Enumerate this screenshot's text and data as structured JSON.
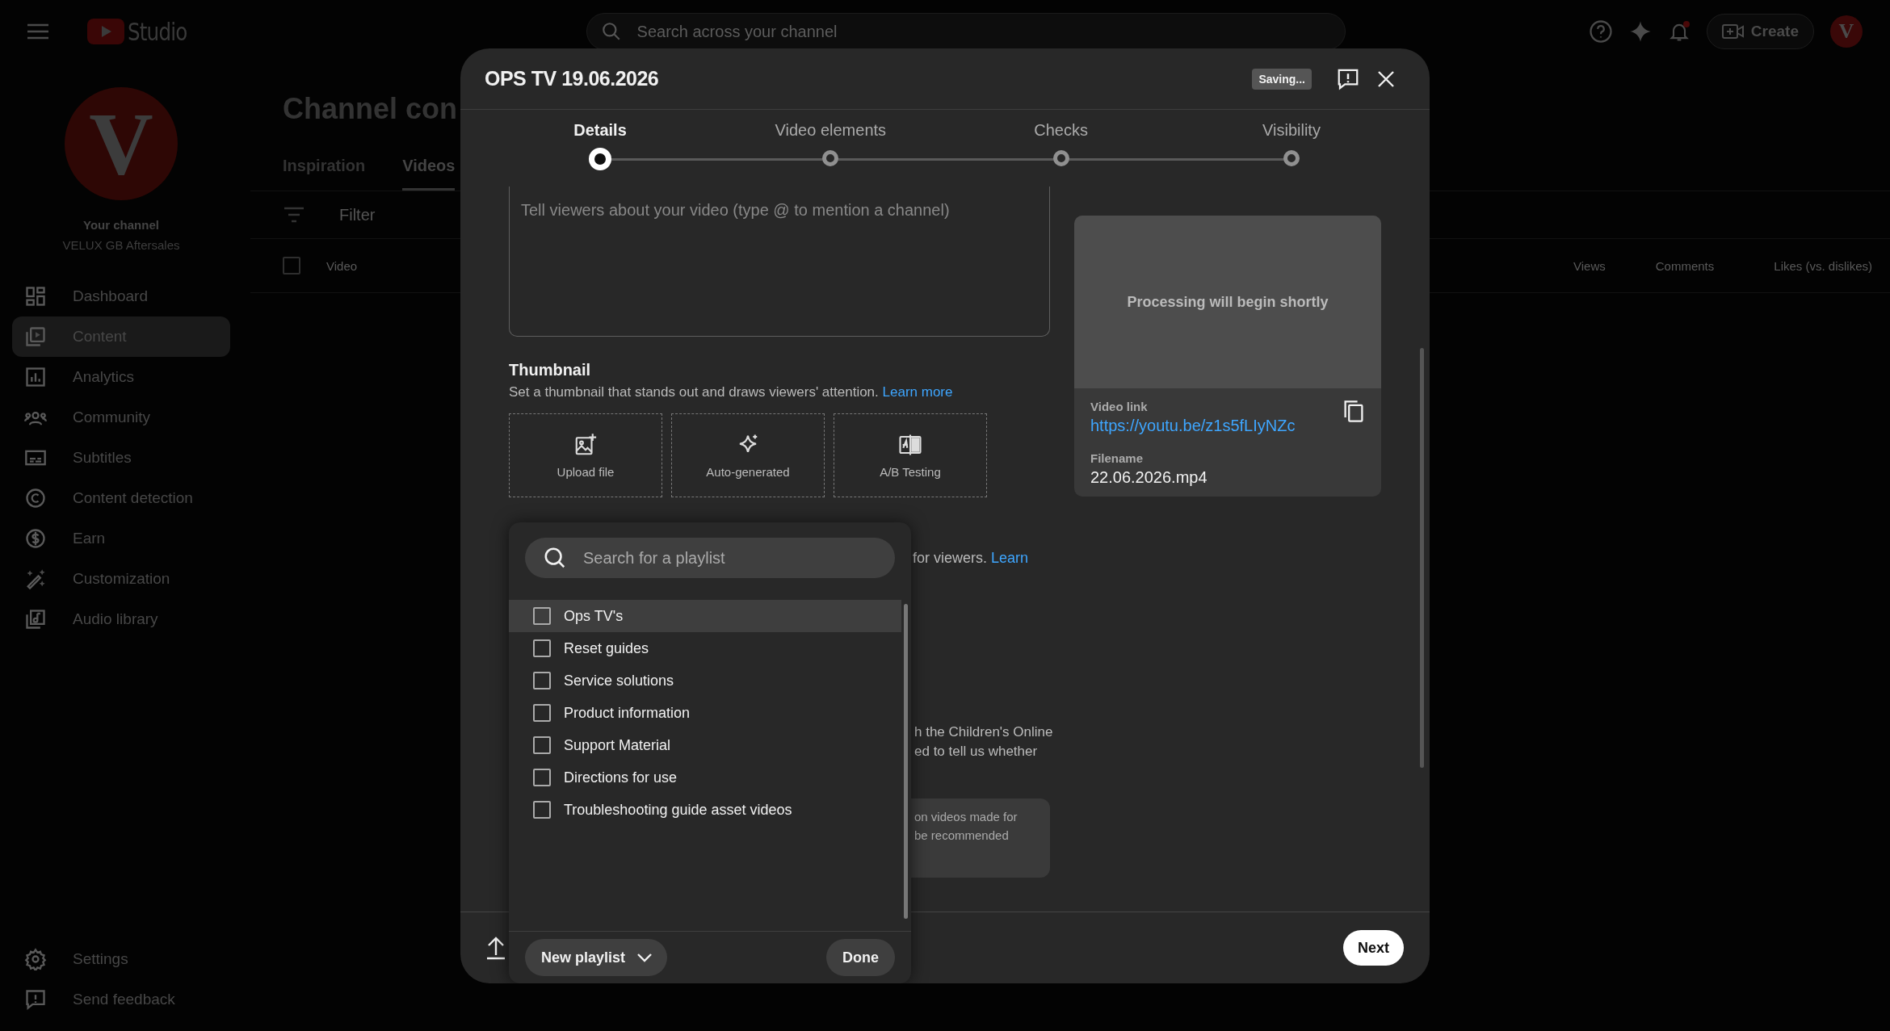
{
  "topbar": {
    "brand": "Studio",
    "search": {
      "placeholder": "Search across your channel"
    },
    "create_label": "Create",
    "avatar_letter": "V",
    "notification_dot": true
  },
  "sidebar": {
    "avatar_letter": "V",
    "channel_label": "Your channel",
    "channel_name": "VELUX GB Aftersales",
    "items": [
      {
        "label": "Dashboard",
        "selected": false
      },
      {
        "label": "Content",
        "selected": true
      },
      {
        "label": "Analytics",
        "selected": false
      },
      {
        "label": "Community",
        "selected": false
      },
      {
        "label": "Subtitles",
        "selected": false
      },
      {
        "label": "Content detection",
        "selected": false
      },
      {
        "label": "Earn",
        "selected": false
      },
      {
        "label": "Customization",
        "selected": false
      },
      {
        "label": "Audio library",
        "selected": false
      }
    ],
    "footer_items": [
      "Settings",
      "Send feedback"
    ]
  },
  "page": {
    "title": "Channel con",
    "tabs": [
      {
        "label": "Inspiration",
        "selected": false
      },
      {
        "label": "Videos",
        "selected": true
      }
    ],
    "filter_placeholder": "Filter",
    "select_all_checked": false,
    "columns": [
      "Video",
      "Views",
      "Comments",
      "Likes (vs. dislikes)"
    ]
  },
  "dialog": {
    "title": "OPS TV 19.06.2026",
    "status_badge": "Saving...",
    "steps": [
      {
        "label": "Details",
        "selected": true
      },
      {
        "label": "Video elements",
        "selected": false
      },
      {
        "label": "Checks",
        "selected": false
      },
      {
        "label": "Visibility",
        "selected": false
      }
    ],
    "description_placeholder": "Tell viewers about your video (type @ to mention a channel)",
    "thumbnail": {
      "heading": "Thumbnail",
      "text": "Set a thumbnail that stands out and draws viewers' attention.",
      "link": "Learn more",
      "options": [
        "Upload file",
        "Auto-generated",
        "A/B Testing"
      ]
    },
    "playlist_text": "for viewers.",
    "playlist_link": "Learn",
    "audience_lines": [
      "h the Children's Online",
      "ed to tell us whether"
    ],
    "notice_lines": [
      "on videos made for",
      "be recommended"
    ],
    "video_card": {
      "status": "Processing will begin shortly",
      "link_label": "Video link",
      "link": "https://youtu.be/z1s5fLIyNZc",
      "filename_label": "Filename",
      "filename": "22.06.2026.mp4"
    },
    "playlist_popup": {
      "search_placeholder": "Search for a playlist",
      "items": [
        {
          "label": "Ops TV's",
          "checked": false,
          "focused": true
        },
        {
          "label": "Reset guides",
          "checked": false,
          "focused": false
        },
        {
          "label": "Service solutions",
          "checked": false,
          "focused": false
        },
        {
          "label": "Product information",
          "checked": false,
          "focused": false
        },
        {
          "label": "Support Material",
          "checked": false,
          "focused": false
        },
        {
          "label": "Directions for use",
          "checked": false,
          "focused": false
        },
        {
          "label": "Troubleshooting guide asset videos",
          "checked": false,
          "focused": false
        }
      ],
      "new_playlist_label": "New playlist",
      "done_label": "Done"
    },
    "next_label": "Next"
  }
}
